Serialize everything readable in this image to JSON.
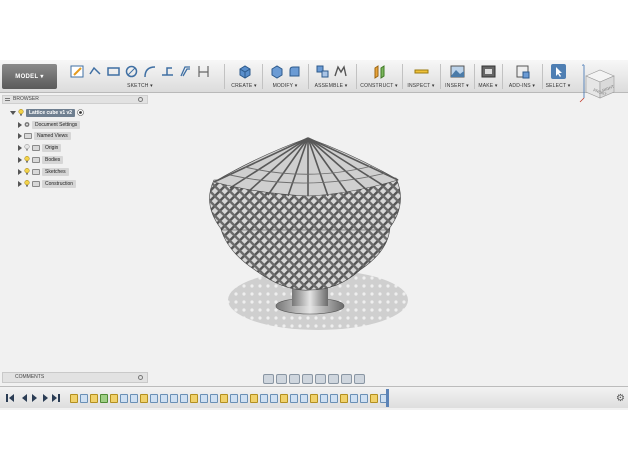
{
  "toolbar": {
    "workspace_label": "MODEL",
    "groups": [
      {
        "label": "SKETCH",
        "icons": [
          "sketch-create-icon",
          "line-icon",
          "rectangle-icon",
          "circle-icon",
          "arc-icon",
          "trim-icon",
          "offset-icon",
          "project-icon"
        ]
      },
      {
        "label": "CREATE",
        "icons": [
          "extrude-box-icon"
        ]
      },
      {
        "label": "MODIFY",
        "icons": [
          "press-pull-icon",
          "fillet-icon"
        ]
      },
      {
        "label": "ASSEMBLE",
        "icons": [
          "new-component-icon",
          "joint-icon"
        ]
      },
      {
        "label": "CONSTRUCT",
        "icons": [
          "offset-plane-icon"
        ]
      },
      {
        "label": "INSPECT",
        "icons": [
          "measure-icon"
        ]
      },
      {
        "label": "INSERT",
        "icons": [
          "insert-image-icon"
        ]
      },
      {
        "label": "MAKE",
        "icons": [
          "3d-print-icon"
        ]
      },
      {
        "label": "ADD-INS",
        "icons": [
          "scripts-icon"
        ]
      },
      {
        "label": "SELECT",
        "icons": [
          "select-arrow-icon"
        ]
      }
    ]
  },
  "viewcube": {
    "face_label": "FRONT",
    "right_label": "RIGHT"
  },
  "browser": {
    "title": "BROWSER",
    "root": "Lattice cube v1 v2",
    "items": [
      {
        "label": "Document Settings"
      },
      {
        "label": "Named Views"
      },
      {
        "label": "Origin"
      },
      {
        "label": "Bodies"
      },
      {
        "label": "Sketches"
      },
      {
        "label": "Construction"
      }
    ]
  },
  "comments": {
    "title": "COMMENTS"
  },
  "colors": {
    "accent": "#5b83b7",
    "toolbar_bg": "#e6e6e6",
    "canvas_bg": "#f1f1f1"
  }
}
